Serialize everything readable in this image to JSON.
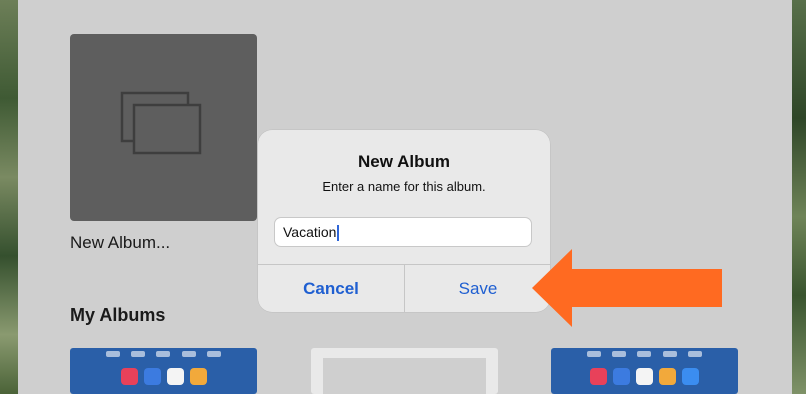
{
  "album_create_tile": {
    "label": "New Album...",
    "icon": "stacked-albums-icon"
  },
  "section": {
    "title": "My Albums"
  },
  "dialog": {
    "title": "New Album",
    "message": "Enter a name for this album.",
    "input_value": "Vacation",
    "cancel_label": "Cancel",
    "save_label": "Save",
    "button_color": "#1f5fd1"
  },
  "annotation": {
    "icon": "pointing-arrow-icon",
    "color": "#ff6a21"
  }
}
